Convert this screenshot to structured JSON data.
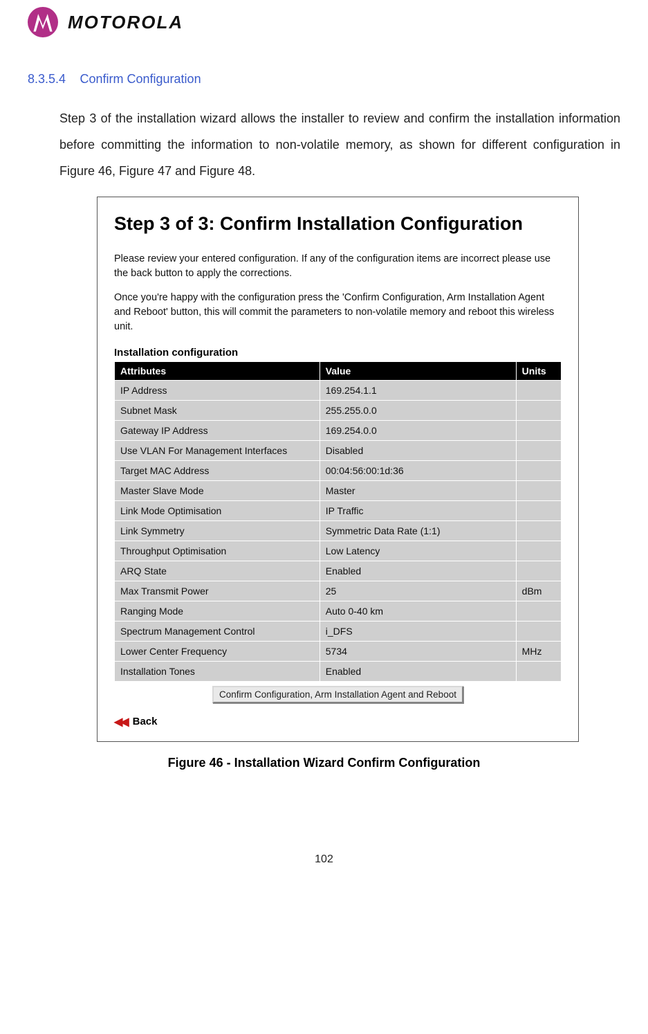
{
  "brand": {
    "word": "MOTOROLA"
  },
  "section": {
    "number": "8.3.5.4",
    "title": "Confirm Configuration"
  },
  "paragraph": "Step 3 of the installation wizard allows the installer to review and confirm the installation information before committing the information to non-volatile memory, as shown for different configuration in Figure 46, Figure 47 and Figure 48.",
  "figure": {
    "heading": "Step 3 of 3: Confirm Installation Configuration",
    "para1": "Please review your entered configuration. If any of the configuration items are incorrect please use the back button to apply the corrections.",
    "para2": "Once you're happy with the configuration press the 'Confirm Configuration, Arm Installation Agent and Reboot' button, this will commit the parameters to non-volatile memory and reboot this wireless unit.",
    "subhead": "Installation configuration",
    "headers": {
      "attr": "Attributes",
      "value": "Value",
      "units": "Units"
    },
    "rows": [
      {
        "attr": "IP Address",
        "value": "169.254.1.1",
        "units": ""
      },
      {
        "attr": "Subnet Mask",
        "value": "255.255.0.0",
        "units": ""
      },
      {
        "attr": "Gateway IP Address",
        "value": "169.254.0.0",
        "units": ""
      },
      {
        "attr": "Use VLAN For Management Interfaces",
        "value": "Disabled",
        "units": ""
      },
      {
        "attr": "Target MAC Address",
        "value": "00:04:56:00:1d:36",
        "units": ""
      },
      {
        "attr": "Master Slave Mode",
        "value": "Master",
        "units": ""
      },
      {
        "attr": "Link Mode Optimisation",
        "value": "IP Traffic",
        "units": ""
      },
      {
        "attr": "Link Symmetry",
        "value": "Symmetric Data Rate (1:1)",
        "units": ""
      },
      {
        "attr": "Throughput Optimisation",
        "value": "Low Latency",
        "units": ""
      },
      {
        "attr": "ARQ State",
        "value": "Enabled",
        "units": ""
      },
      {
        "attr": "Max Transmit Power",
        "value": "25",
        "units": "dBm"
      },
      {
        "attr": "Ranging Mode",
        "value": "Auto 0-40 km",
        "units": ""
      },
      {
        "attr": "Spectrum Management Control",
        "value": "i_DFS",
        "units": ""
      },
      {
        "attr": "Lower Center Frequency",
        "value": "5734",
        "units": "MHz"
      },
      {
        "attr": "Installation Tones",
        "value": "Enabled",
        "units": ""
      }
    ],
    "button": "Confirm Configuration, Arm Installation Agent and Reboot",
    "back": "Back",
    "caption": "Figure 46 - Installation Wizard Confirm Configuration"
  },
  "page_number": "102"
}
